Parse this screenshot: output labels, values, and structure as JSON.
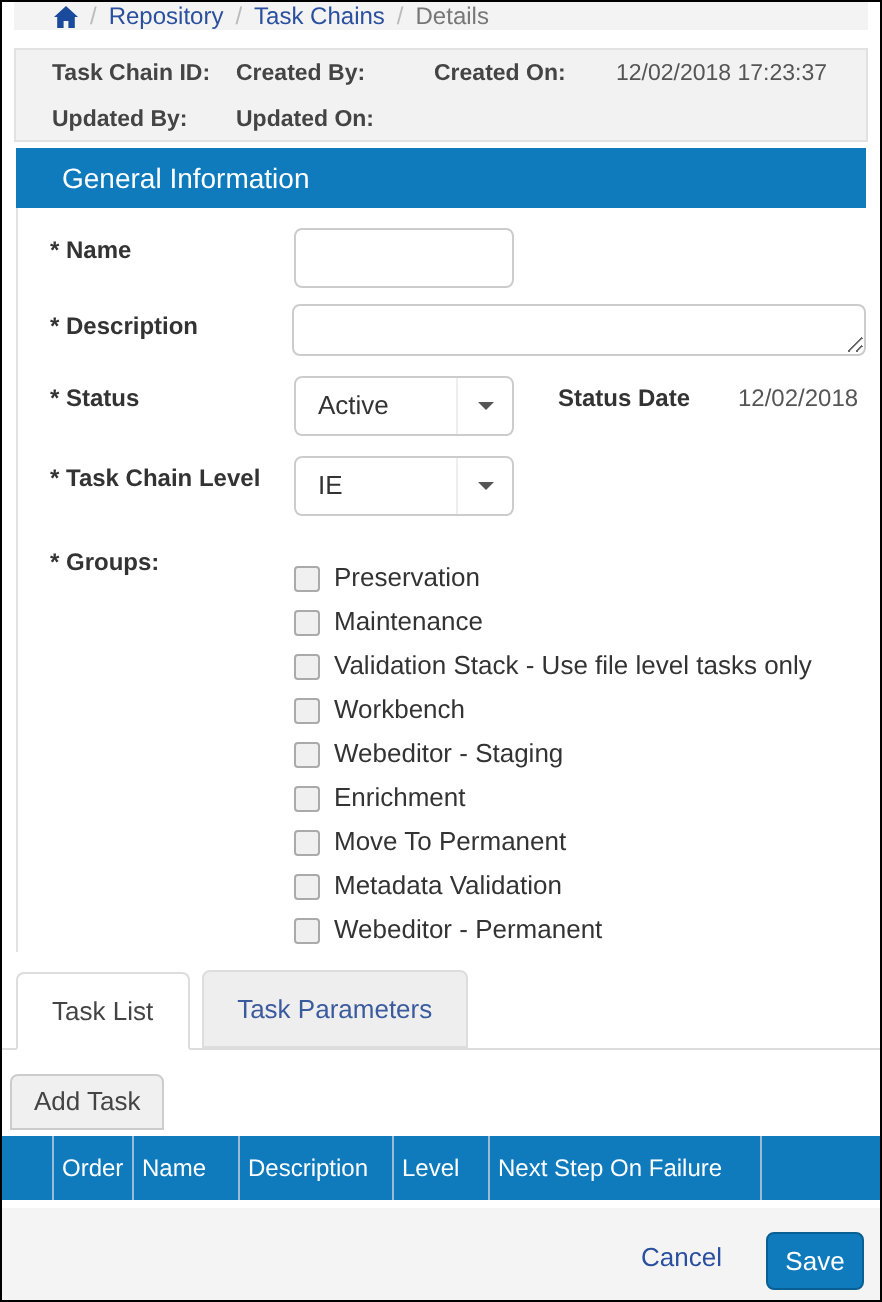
{
  "breadcrumb": [
    "Repository",
    "Task Chains",
    "Details"
  ],
  "breadcrumb_separator": "/",
  "info": [
    {
      "label": "Task Chain ID:"
    },
    {
      "label": "Created By:"
    },
    {
      "label": "Created On:",
      "value": "12/02/2018 17:23:37"
    },
    {
      "label": "Updated By:"
    },
    {
      "label": "Updated On:"
    }
  ],
  "section": {
    "title": "General Information"
  },
  "form": {
    "name": {
      "label": "* Name"
    },
    "description": {
      "label": "* Description"
    },
    "status": {
      "label": "* Status",
      "value": "Active"
    },
    "status_date": {
      "label": "Status Date",
      "value": "12/02/2018"
    },
    "level": {
      "label": "* Task Chain Level",
      "value": "IE"
    },
    "groups_label": "* Groups:"
  },
  "groups": [
    {
      "label": "Preservation",
      "checked": false
    },
    {
      "label": "Maintenance",
      "checked": false
    },
    {
      "label": "Validation Stack - Use file level tasks only",
      "checked": false
    },
    {
      "label": "Workbench",
      "checked": false
    },
    {
      "label": "Webeditor - Staging",
      "checked": false
    },
    {
      "label": "Enrichment",
      "checked": false
    },
    {
      "label": "Move To Permanent",
      "checked": false
    },
    {
      "label": "Metadata Validation",
      "checked": false
    },
    {
      "label": "Webeditor - Permanent",
      "checked": false
    }
  ],
  "tabs": [
    {
      "label": "Task List",
      "selected": true
    },
    {
      "label": "Task Parameters",
      "selected": false
    }
  ],
  "add_button": "Add Task",
  "table": {
    "columns": [
      "Order",
      "Name",
      "Description",
      "Level",
      "Next Step On Failure"
    ]
  },
  "footer": {
    "cancel": "Cancel",
    "save": "Save"
  }
}
